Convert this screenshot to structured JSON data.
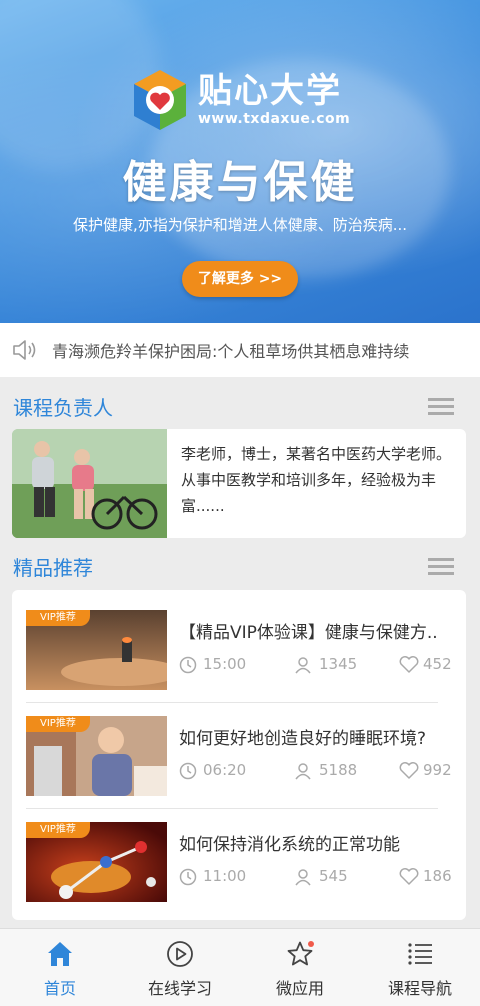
{
  "hero": {
    "brand_name": "贴心大学",
    "brand_url": "www.txdaxue.com",
    "title": "健康与保健",
    "subtitle": "保护健康,亦指为保护和增进人体健康、防治疾病...",
    "button_label": "了解更多 >>"
  },
  "notice": {
    "icon": "speaker-icon",
    "text": "青海濒危羚羊保护困局:个人租草场供其栖息难持续"
  },
  "teacher_section": {
    "title": "课程负责人",
    "description": "李老师，博士，某著名中医药大学老师。从事中医教学和培训多年，经验极为丰富......"
  },
  "recommend_section": {
    "title": "精品推荐",
    "items": [
      {
        "badge": "VIP推荐",
        "title": "【精品VIP体验课】健康与保健方..",
        "duration": "15:00",
        "views": "1345",
        "likes": "452"
      },
      {
        "badge": "VIP推荐",
        "title": "如何更好地创造良好的睡眠环境?",
        "duration": "06:20",
        "views": "5188",
        "likes": "992"
      },
      {
        "badge": "VIP推荐",
        "title": "如何保持消化系统的正常功能",
        "duration": "11:00",
        "views": "545",
        "likes": "186"
      }
    ]
  },
  "tabbar": {
    "tabs": [
      {
        "label": "首页",
        "icon": "home-icon",
        "active": true
      },
      {
        "label": "在线学习",
        "icon": "play-icon",
        "active": false
      },
      {
        "label": "微应用",
        "icon": "star-icon",
        "active": false
      },
      {
        "label": "课程导航",
        "icon": "list-icon",
        "active": false
      }
    ]
  },
  "colors": {
    "accent": "#2f86d9",
    "orange": "#f08c1a",
    "badge_dot": "#f05a4a"
  }
}
